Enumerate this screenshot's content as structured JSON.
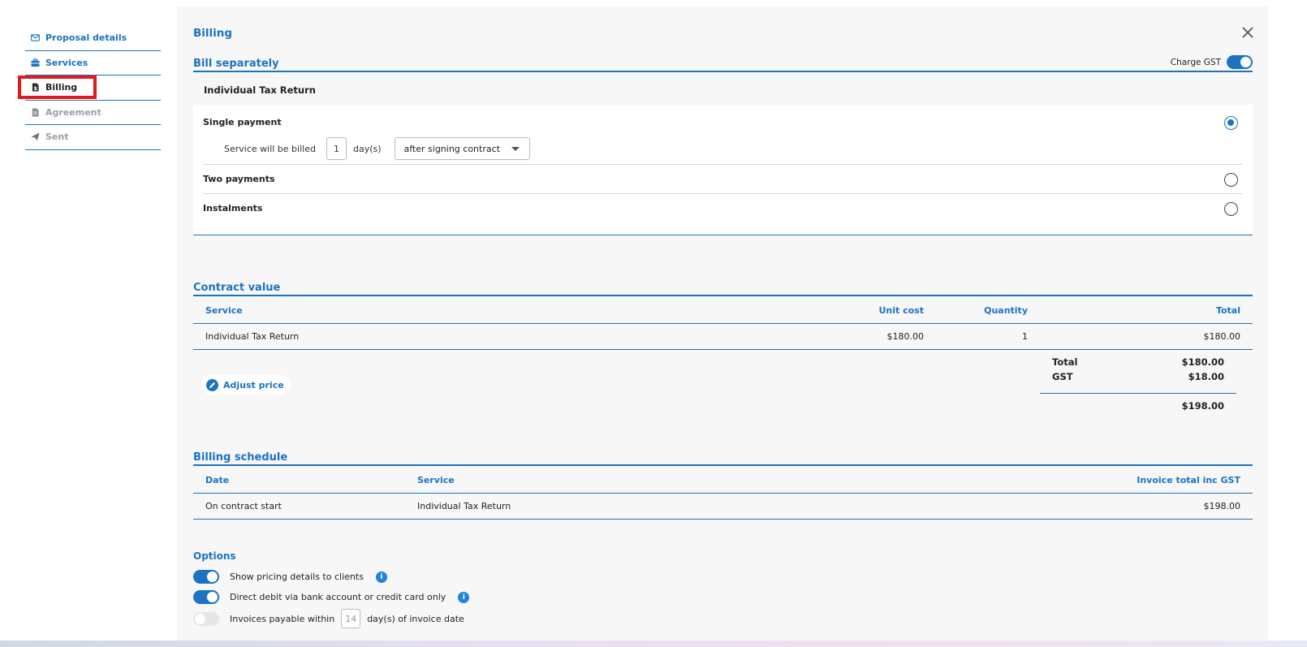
{
  "sidebar": {
    "items": [
      {
        "label": "Proposal details",
        "icon": "envelope-icon",
        "state": "link"
      },
      {
        "label": "Services",
        "icon": "briefcase-icon",
        "state": "link"
      },
      {
        "label": "Billing",
        "icon": "invoice-icon",
        "state": "active"
      },
      {
        "label": "Agreement",
        "icon": "document-icon",
        "state": "disabled"
      },
      {
        "label": "Sent",
        "icon": "send-icon",
        "state": "disabled"
      }
    ]
  },
  "panel": {
    "title": "Billing",
    "close_icon": "close-icon"
  },
  "bill_separately": {
    "heading": "Bill separately",
    "charge_gst_label": "Charge GST",
    "charge_gst_on": true,
    "service_name": "Individual Tax Return",
    "single_payment": {
      "label": "Single payment",
      "selected": true,
      "billed_prefix": "Service will be billed",
      "days_value": "1",
      "days_unit": "day(s)",
      "timing_selected": "after signing contract"
    },
    "two_payments": {
      "label": "Two payments",
      "selected": false
    },
    "instalments": {
      "label": "Instalments",
      "selected": false
    }
  },
  "contract_value": {
    "heading": "Contract value",
    "columns": {
      "service": "Service",
      "unit_cost": "Unit cost",
      "quantity": "Quantity",
      "total": "Total"
    },
    "rows": [
      {
        "service": "Individual Tax Return",
        "unit_cost": "$180.00",
        "quantity": "1",
        "total": "$180.00"
      }
    ],
    "adjust_price_label": "Adjust price",
    "summary": {
      "total_label": "Total",
      "total_value": "$180.00",
      "gst_label": "GST",
      "gst_value": "$18.00",
      "grand_total": "$198.00"
    }
  },
  "billing_schedule": {
    "heading": "Billing schedule",
    "columns": {
      "date": "Date",
      "service": "Service",
      "invoice_total": "Invoice total inc GST"
    },
    "rows": [
      {
        "date": "On contract start",
        "service": "Individual Tax Return",
        "invoice_total": "$198.00"
      }
    ]
  },
  "options": {
    "heading": "Options",
    "show_pricing_label": "Show pricing details to clients",
    "show_pricing_on": true,
    "direct_debit_label": "Direct debit via bank account or credit card only",
    "direct_debit_on": true,
    "invoices_payable_prefix": "Invoices payable within",
    "invoices_payable_days": "14",
    "invoices_payable_suffix": "day(s) of invoice date",
    "invoices_payable_on": false
  },
  "colors": {
    "accent": "#1c73c2",
    "highlight": "#e01b1b",
    "panel_bg": "#f7f7f7"
  }
}
